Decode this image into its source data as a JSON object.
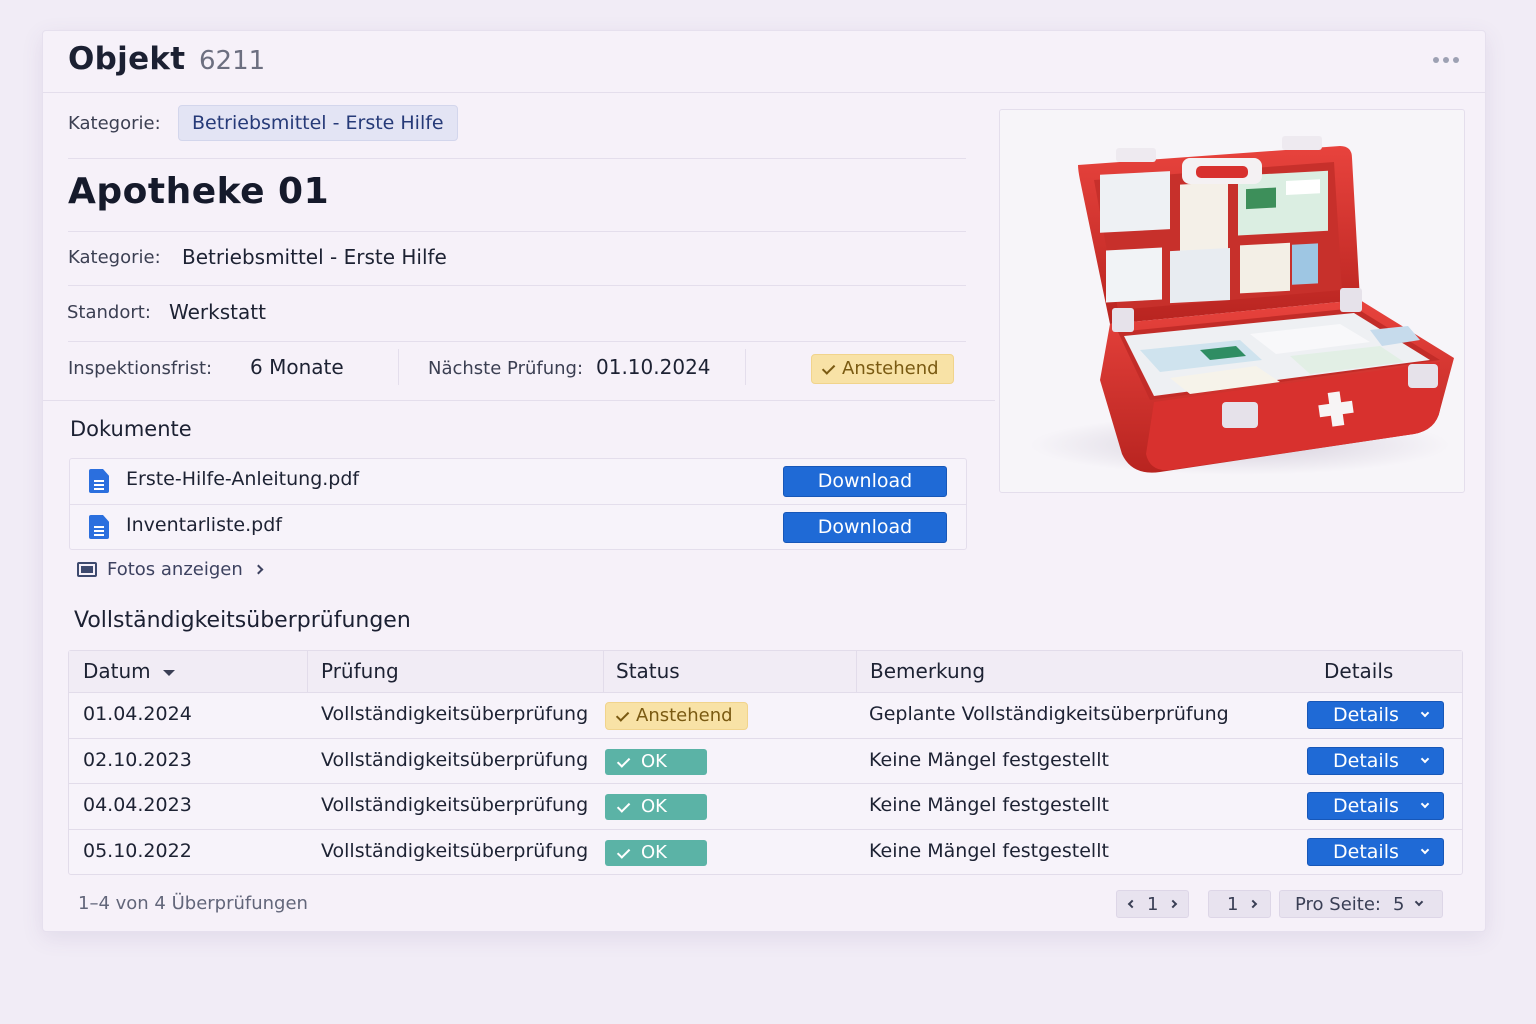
{
  "header": {
    "title": "Objekt",
    "id": "6211"
  },
  "category_badge": {
    "label": "Kategorie:",
    "value": "Betriebsmittel - Erste Hilfe"
  },
  "object": {
    "name": "Apotheke 01",
    "category_label": "Kategorie:",
    "category_value": "Betriebsmittel - Erste Hilfe",
    "location_label": "Standort:",
    "location_value": "Werkstatt",
    "interval_label": "Inspektionsfrist:",
    "interval_value": "6 Monate",
    "next_check_label": "Nächste Prüfung:",
    "next_check_value": "01.10.2024",
    "status": "Anstehend"
  },
  "documents": {
    "title": "Dokumente",
    "items": [
      {
        "name": "Erste-Hilfe-Anleitung.pdf",
        "button": "Download"
      },
      {
        "name": "Inventarliste.pdf",
        "button": "Download"
      }
    ],
    "photos_link": "Fotos anzeigen"
  },
  "image": {
    "subject": "Erste-Hilfe-Koffer",
    "icon": "first-aid-kit"
  },
  "checks": {
    "title": "Vollständigkeitsüberprüfungen",
    "columns": [
      "Datum",
      "Prüfung",
      "Status",
      "Bemerkung",
      "Details"
    ],
    "rows": [
      {
        "date": "01.04.2024",
        "type": "Vollständigkeitsüberprüfung",
        "status": "Anstehend",
        "status_kind": "pending",
        "remark": "Geplante Vollständigkeitsüberprüfung",
        "button": "Details"
      },
      {
        "date": "02.10.2023",
        "type": "Vollständigkeitsüberprüfung",
        "status": "OK",
        "status_kind": "ok",
        "remark": "Keine Mängel festgestellt",
        "button": "Details"
      },
      {
        "date": "04.04.2023",
        "type": "Vollständigkeitsüberprüfung",
        "status": "OK",
        "status_kind": "ok",
        "remark": "Keine Mängel festgestellt",
        "button": "Details"
      },
      {
        "date": "05.10.2022",
        "type": "Vollständigkeitsüberprüfung",
        "status": "OK",
        "status_kind": "ok",
        "remark": "Keine Mängel festgestellt",
        "button": "Details"
      }
    ]
  },
  "pagination": {
    "summary": "1–4 von 4 Überprüfungen",
    "page": "1",
    "page_alt": "1",
    "per_page_label": "Pro Seite:",
    "per_page_value": "5"
  },
  "colors": {
    "primary": "#1f6ad6",
    "ok": "#5bb3a6",
    "pending": "#f8e2a6",
    "kit_red": "#d8312e"
  }
}
